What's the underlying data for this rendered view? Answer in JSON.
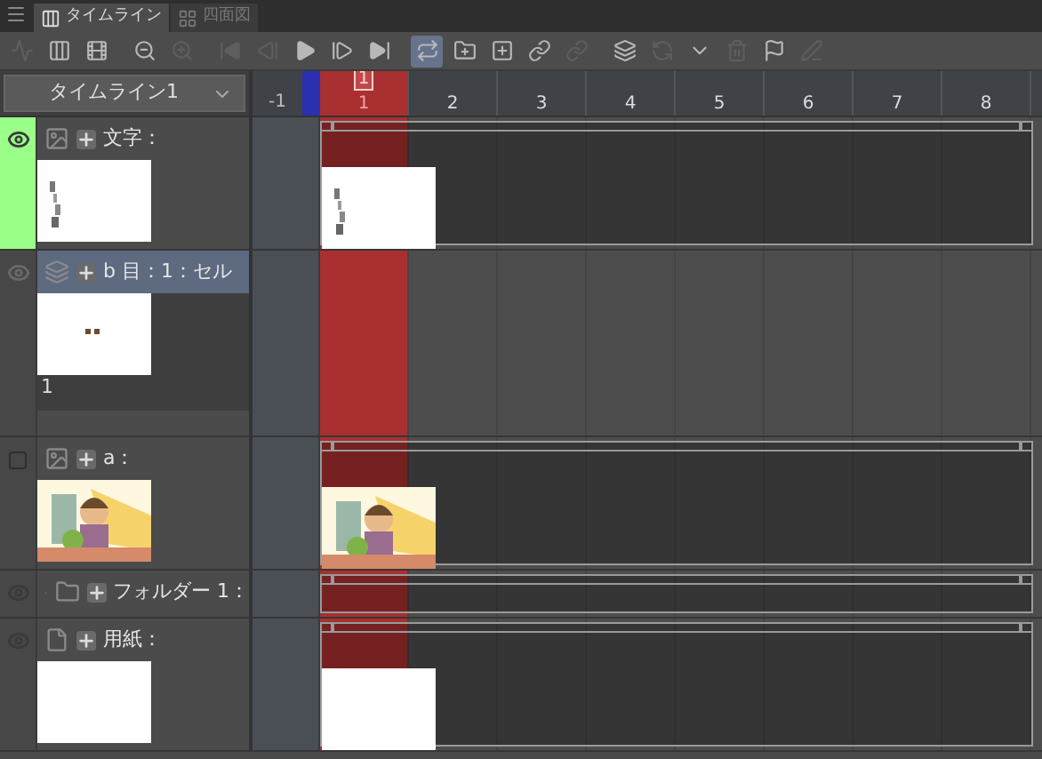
{
  "tabs": [
    {
      "label": "タイムライン",
      "selected": true,
      "kind": "timeline"
    },
    {
      "label": "四面図",
      "selected": false,
      "kind": "views"
    }
  ],
  "toolbar": [
    {
      "kind": "graph",
      "disabled": true,
      "on": false
    },
    {
      "kind": "new-timeline",
      "disabled": false,
      "on": false
    },
    {
      "kind": "edit-timeline",
      "disabled": false,
      "on": false
    },
    {
      "kind": "zoom-out",
      "disabled": false,
      "on": false
    },
    {
      "kind": "zoom-in",
      "disabled": true,
      "on": false
    },
    {
      "kind": "first",
      "disabled": true,
      "on": false
    },
    {
      "kind": "prev",
      "disabled": true,
      "on": false
    },
    {
      "kind": "play",
      "disabled": false,
      "on": false
    },
    {
      "kind": "next",
      "disabled": false,
      "on": false
    },
    {
      "kind": "last",
      "disabled": false,
      "on": false
    },
    {
      "kind": "loop",
      "disabled": false,
      "on": true
    },
    {
      "kind": "new-folder",
      "disabled": false,
      "on": false
    },
    {
      "kind": "new-cel",
      "disabled": false,
      "on": false
    },
    {
      "kind": "assign",
      "disabled": false,
      "on": false
    },
    {
      "kind": "assign",
      "disabled": true,
      "on": false
    },
    {
      "kind": "onion",
      "disabled": false,
      "on": false
    },
    {
      "kind": "transform",
      "disabled": true,
      "on": false
    },
    {
      "kind": "dropdown",
      "disabled": false,
      "on": false
    },
    {
      "kind": "delete",
      "disabled": true,
      "on": false
    },
    {
      "kind": "flag",
      "disabled": false,
      "on": false
    },
    {
      "kind": "pen",
      "disabled": true,
      "on": false
    }
  ],
  "timeline_selector": {
    "value": "タイムライン1"
  },
  "ruler": {
    "current_marker": "1",
    "frames": [
      {
        "label": "-1",
        "current": false
      },
      {
        "label": "1",
        "current": true
      },
      {
        "label": "2",
        "current": false
      },
      {
        "label": "3",
        "current": false
      },
      {
        "label": "4",
        "current": false
      },
      {
        "label": "5",
        "current": false
      },
      {
        "label": "6",
        "current": false
      },
      {
        "label": "7",
        "current": false
      },
      {
        "label": "8",
        "current": false
      }
    ]
  },
  "layers": [
    {
      "kind": "raster",
      "name": "文字：",
      "visible": true,
      "dimmed": false,
      "color": "#99ff88",
      "selected": false,
      "thumbnail": {
        "kind": "text"
      },
      "clip": true
    },
    {
      "kind": "animation",
      "name": "b 目：1：セル",
      "visible": true,
      "dimmed": true,
      "selected": true,
      "thumbnail": {
        "kind": "dots"
      },
      "thumb_caption": "1",
      "clip": false
    },
    {
      "kind": "raster",
      "name": "a：",
      "visible": false,
      "dimmed": false,
      "selected": false,
      "clip": true
    },
    {
      "kind": "folder",
      "name": "フォルダー 1：",
      "visible": true,
      "dimmed": false,
      "selected": false,
      "expanded": false,
      "clip": true
    },
    {
      "kind": "paper",
      "name": "用紙：",
      "visible": true,
      "dimmed": false,
      "selected": false,
      "thumbnail": {
        "kind": "blank"
      },
      "clip": true
    }
  ]
}
